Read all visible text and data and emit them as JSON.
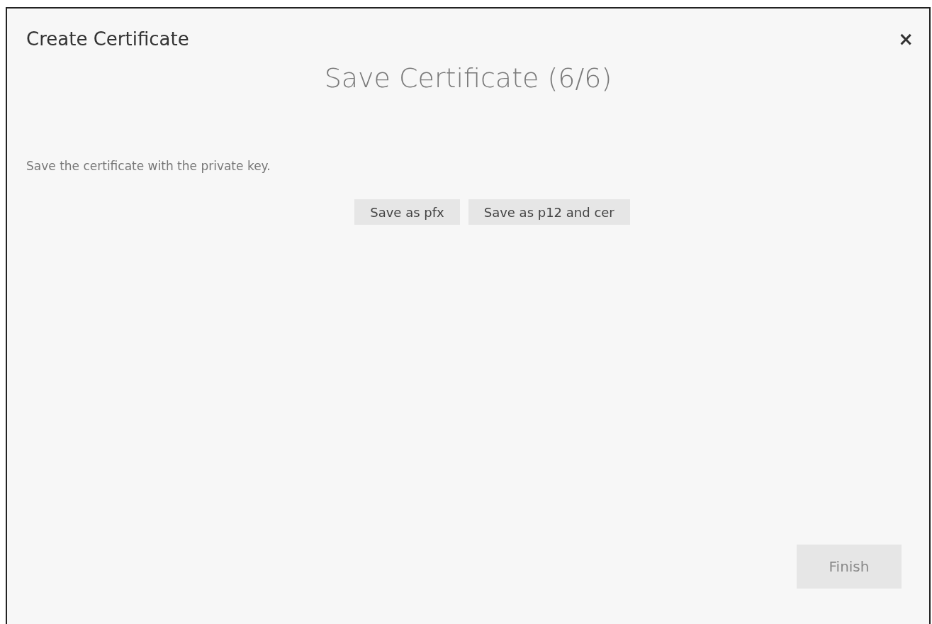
{
  "dialog": {
    "title": "Create Certificate",
    "close": "×"
  },
  "step": {
    "heading": "Save Certificate (6/6)",
    "description": "Save the certificate with the private key."
  },
  "save_buttons": [
    {
      "label": "Save as pfx"
    },
    {
      "label": "Save as p12 and cer"
    }
  ],
  "finish_button": {
    "label": "Finish",
    "disabled": true
  }
}
